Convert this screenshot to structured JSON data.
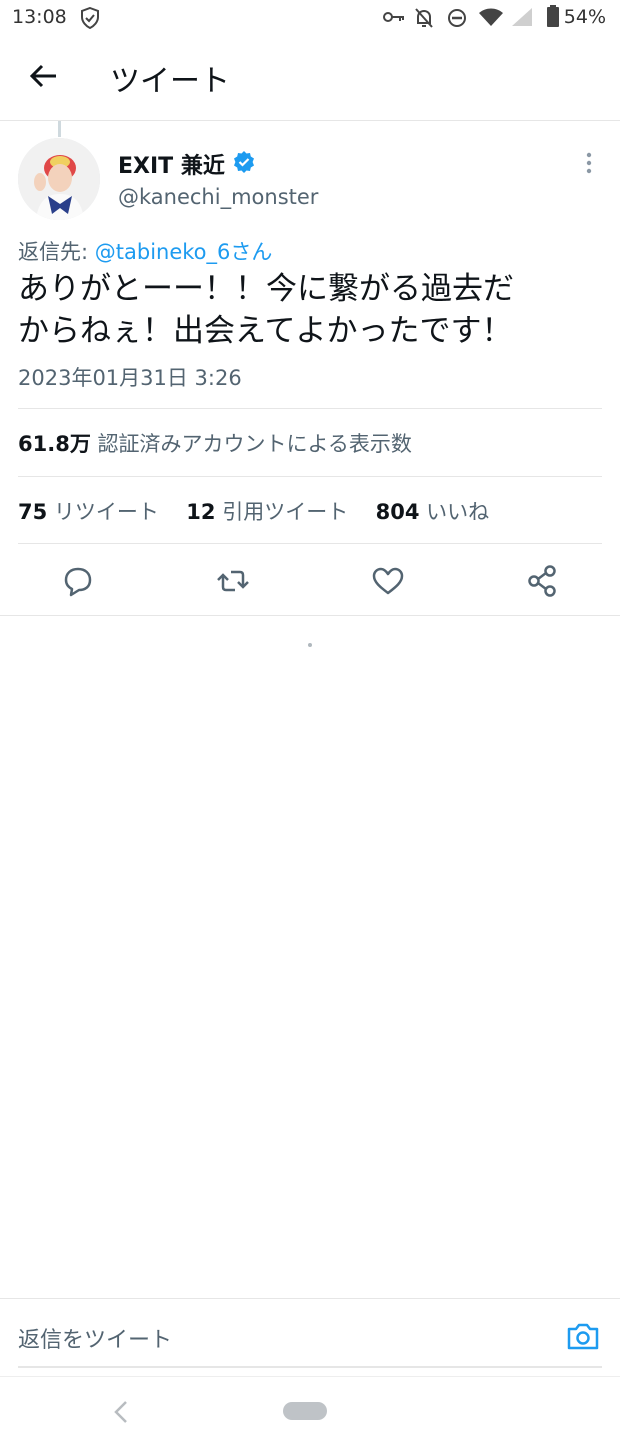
{
  "status_bar": {
    "time": "13:08",
    "battery": "54%"
  },
  "header": {
    "title": "ツイート"
  },
  "tweet": {
    "author_name": "EXIT 兼近",
    "handle": "@kanechi_monster",
    "reply_label": "返信先: ",
    "reply_mention": "@tabineko_6さん",
    "text_line1": "ありがとーー！！今に繋がる過去だ",
    "text_line2": "からねぇ！出会えてよかったです！",
    "timestamp": "2023年01月31日 3:26"
  },
  "stats": {
    "views_count": "61.8万",
    "views_label": "認証済みアカウントによる表示数",
    "retweets_count": "75",
    "retweets_label": "リツイート",
    "quotes_count": "12",
    "quotes_label": "引用ツイート",
    "likes_count": "804",
    "likes_label": "いいね"
  },
  "composer": {
    "placeholder": "返信をツイート"
  },
  "colors": {
    "accent": "#1d9bf0",
    "secondary_text": "#536471"
  },
  "icons": [
    "back-arrow-icon",
    "verified-badge-icon",
    "more-icon",
    "reply-icon",
    "retweet-icon",
    "like-icon",
    "share-icon",
    "camera-icon"
  ]
}
